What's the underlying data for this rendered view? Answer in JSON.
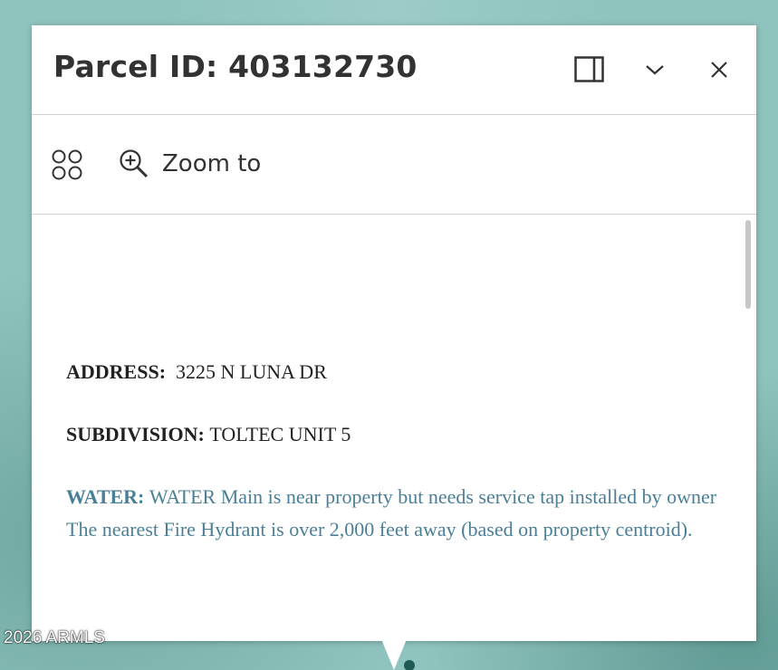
{
  "popup": {
    "title": "Parcel ID: 403132730",
    "header_buttons": {
      "dock_icon": "dock-panel-icon",
      "collapse_icon": "chevron-down-icon",
      "close_icon": "close-icon"
    },
    "actions": {
      "menu_icon": "actions-grid-icon",
      "zoom_icon": "zoom-in-icon",
      "zoom_label": "Zoom to"
    },
    "content": {
      "address_label": "ADDRESS:",
      "address_value": "3225 N LUNA DR",
      "subdivision_label": "SUBDIVISION:",
      "subdivision_value": "TOLTEC UNIT 5",
      "water_label": "WATER:",
      "water_value": "WATER Main is near property but needs service tap installed by owner",
      "hydrant_note": "The nearest Fire Hydrant is over 2,000 feet away (based on property centroid)."
    }
  },
  "watermark": "2026 ARMLS",
  "colors": {
    "map_background": "#8fc3bd",
    "water_text": "#4a7f98",
    "title_text": "#323232"
  }
}
